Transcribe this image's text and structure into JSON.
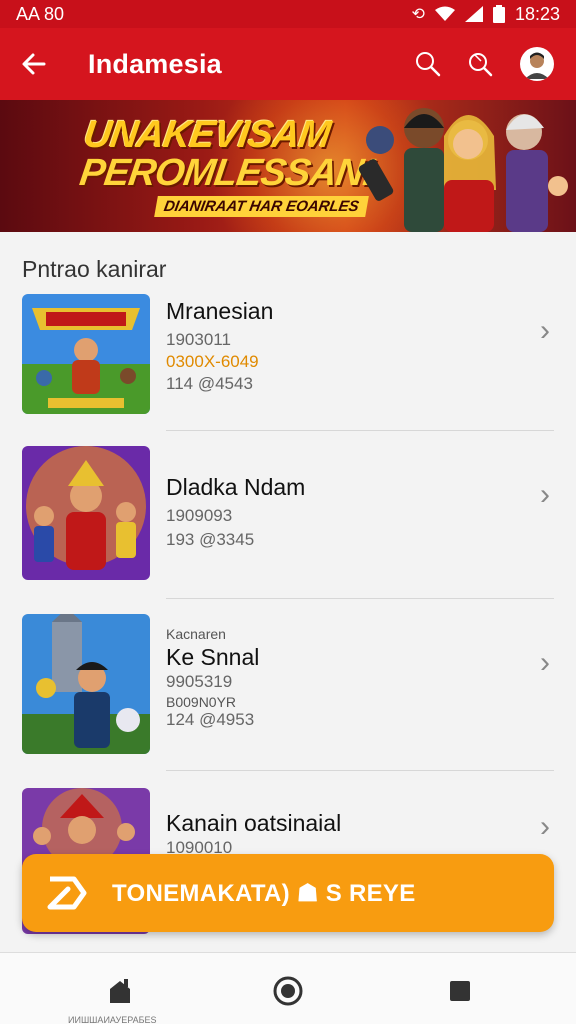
{
  "status": {
    "left": "AA 80",
    "time": "18:23"
  },
  "appbar": {
    "title": "Indamesia"
  },
  "banner": {
    "line1": "UNAKEVISAM",
    "line2": "PEROMLESSAN!",
    "line3": "DIANIRAAT HAR EOARLES"
  },
  "section": {
    "title": "Pntrao kanirar"
  },
  "items": [
    {
      "name": "Mranesian",
      "sub1": "1903011",
      "orange": "0300X-6049",
      "sub2": "114 @4543"
    },
    {
      "name": "Dladka Ndam",
      "sub1": "1909093",
      "sub2": "193 @3345"
    },
    {
      "small1": "Kacnaren",
      "name": "Ke Snnal",
      "sub1": "9905319",
      "small2": "B009N0YR",
      "sub2": "124 @4953"
    },
    {
      "name": "Kanain oatsinaial",
      "sub1": "1090010"
    }
  ],
  "cta": {
    "label": "TONEMAKATA) ☗ S REYE"
  },
  "bottomnav": {
    "caption": "ИИШШАИАУЕРАБЕS"
  },
  "colors": {
    "primary": "#d5151e",
    "accent": "#f89c10",
    "statusbar": "#c8101a"
  },
  "icons": [
    "back-arrow-icon",
    "search-icon",
    "search-alt-icon",
    "avatar",
    "chevron-right-icon",
    "play-icon",
    "home-icon",
    "circle-icon",
    "square-icon"
  ]
}
